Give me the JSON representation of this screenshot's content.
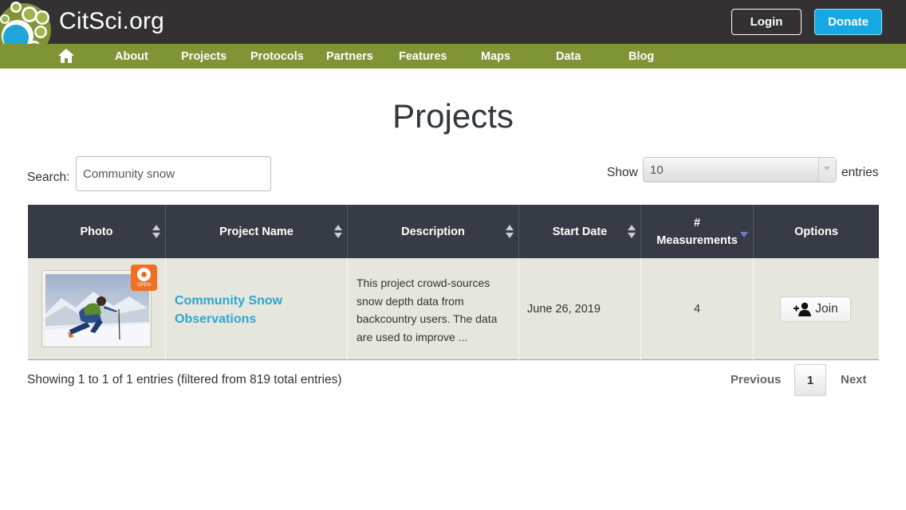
{
  "brand": {
    "name": "CitSci.org"
  },
  "header": {
    "login_label": "Login",
    "donate_label": "Donate",
    "donate_color": "#13a9e5"
  },
  "nav": {
    "home_icon": "home-icon",
    "items": [
      "About",
      "Projects",
      "Protocols",
      "Partners",
      "Features",
      "Maps",
      "Data",
      "Blog"
    ],
    "background": "#7f9435"
  },
  "page": {
    "title": "Projects"
  },
  "search": {
    "label": "Search:",
    "value": "Community snow"
  },
  "length": {
    "show_label": "Show",
    "selected": "10",
    "entries_label": "entries"
  },
  "table": {
    "columns": [
      {
        "label": "Photo",
        "sort": "both"
      },
      {
        "label": "Project Name",
        "sort": "both"
      },
      {
        "label": "Description",
        "sort": "both"
      },
      {
        "label": "Start Date",
        "sort": "both"
      },
      {
        "label_line1": "#",
        "label_line2": "Measurements",
        "sort": "desc"
      },
      {
        "label": "Options",
        "sort": "none"
      }
    ],
    "rows": [
      {
        "badge": "OPEN",
        "name_line1": "Community Snow",
        "name_line2": "Observations",
        "desc_lines": [
          "This project crowd-sources",
          "snow depth data from",
          "backcountry users. The data",
          "are used to improve ..."
        ],
        "start_date": "June 26, 2019",
        "measurements": "4",
        "action": "Join"
      }
    ]
  },
  "footer": {
    "info": "Showing 1 to 1 of 1 entries (filtered from 819 total entries)",
    "previous_label": "Previous",
    "current_page": "1",
    "next_label": "Next"
  }
}
